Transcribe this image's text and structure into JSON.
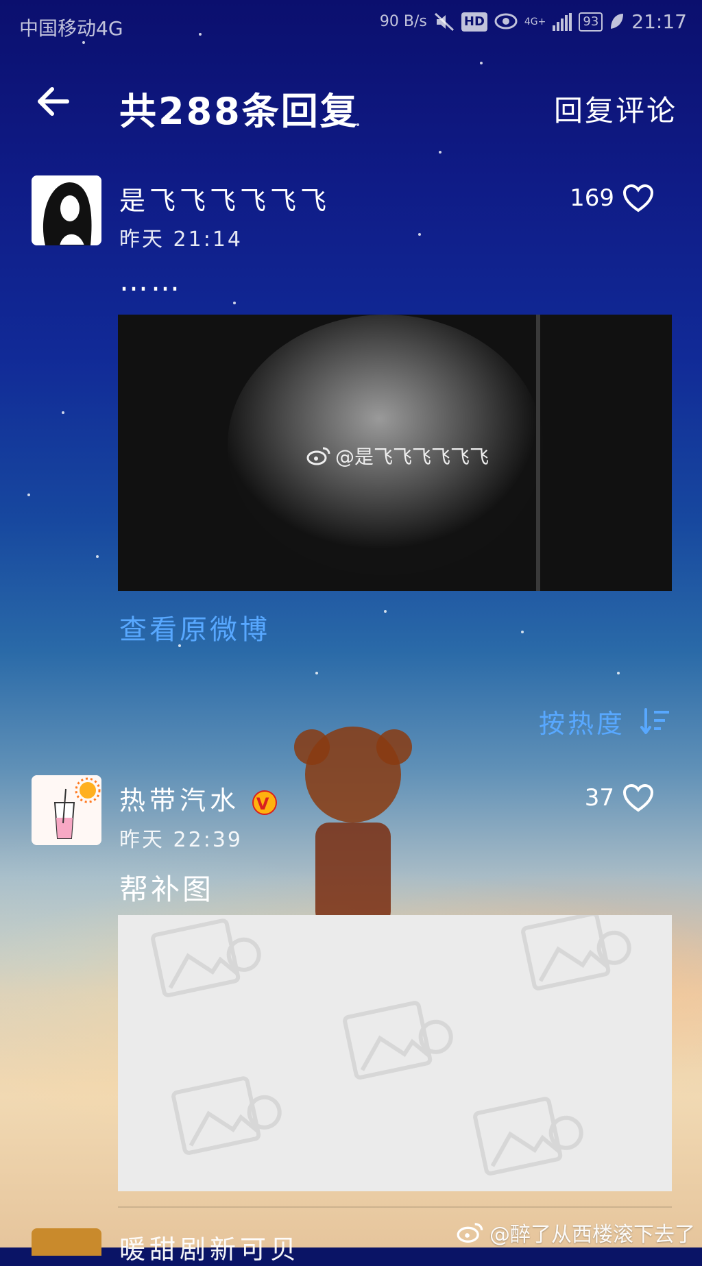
{
  "status_bar": {
    "carrier": "中国移动4G",
    "net_speed": "90 B/s",
    "hd": "HD",
    "network": "4G+",
    "battery": "93",
    "time": "21:17"
  },
  "header": {
    "title": "共288条回复",
    "reply_button": "回复评论"
  },
  "original_post": {
    "username": "是飞飞飞飞飞飞",
    "time": "昨天 21:14",
    "likes": "169",
    "text": "……",
    "image_watermark": "@是飞飞飞飞飞飞",
    "view_original": "查看原微博"
  },
  "sort": {
    "label": "按热度"
  },
  "replies": [
    {
      "username": "热带汽水",
      "verified_badge": "V",
      "time": "昨天 22:39",
      "likes": "37",
      "text": "帮补图"
    },
    {
      "username": "暖甜剧新可贝"
    }
  ],
  "page_watermark": "@醉了从西楼滚下去了",
  "colors": {
    "link": "#58a8ff",
    "badge": "#ffb20f"
  }
}
